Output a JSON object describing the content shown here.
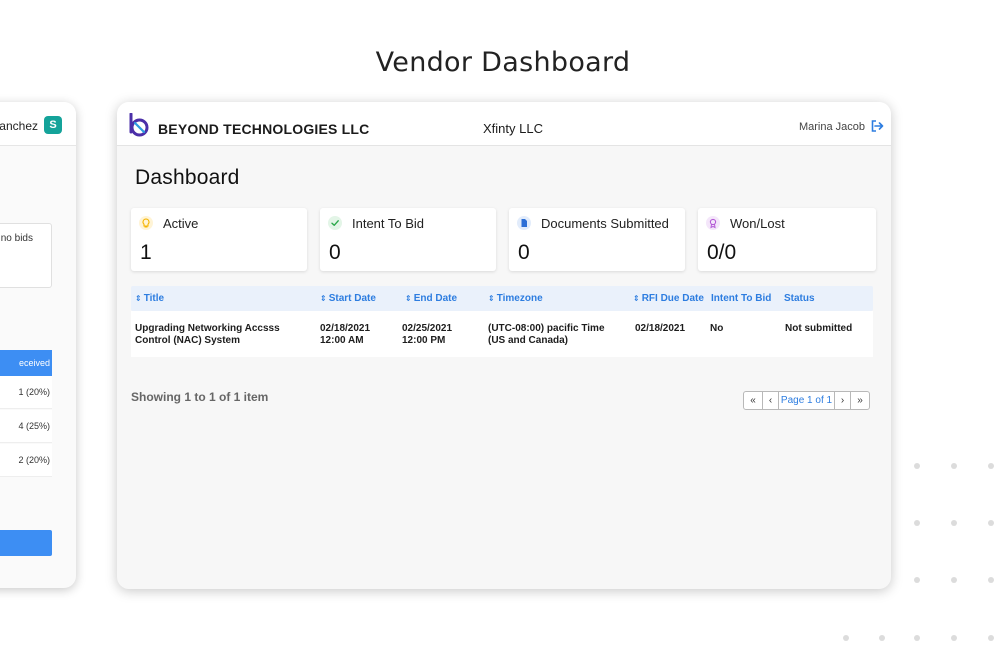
{
  "heading": "Vendor Dashboard",
  "side_card": {
    "user_partial": "anchez",
    "avatar_letter": "S",
    "box_text": "no bids",
    "table_head_partial": "eceived",
    "rows": [
      "1 (20%)",
      "4 (25%)",
      "2 (20%)"
    ]
  },
  "topbar": {
    "company": "BEYOND TECHNOLOGIES LLC",
    "vendor": "Xfinty LLC",
    "user": "Marina Jacob"
  },
  "page_title": "Dashboard",
  "stats": [
    {
      "label": "Active",
      "value": "1",
      "icon": "lightbulb-icon",
      "color": "#f5b400",
      "bg": "#fff4d6"
    },
    {
      "label": "Intent To Bid",
      "value": "0",
      "icon": "check-icon",
      "color": "#2aa84a",
      "bg": "#e3f5e7"
    },
    {
      "label": "Documents Submitted",
      "value": "0",
      "icon": "document-icon",
      "color": "#2d6fd6",
      "bg": "#e2ecfb"
    },
    {
      "label": "Won/Lost",
      "value": "0/0",
      "icon": "award-icon",
      "color": "#b45bd6",
      "bg": "#f4e6fa"
    }
  ],
  "table": {
    "headers": [
      "Title",
      "Start Date",
      "End Date",
      "Timezone",
      "RFI Due Date",
      "Intent To Bid",
      "Status"
    ],
    "rows": [
      {
        "title_line1": "Upgrading Networking Accsss",
        "title_line2": "Control (NAC) System",
        "start_date": "02/18/2021",
        "start_time": "12:00 AM",
        "end_date": "02/25/2021",
        "end_time": "12:00 PM",
        "timezone_line1": "(UTC-08:00)  pacific Time",
        "timezone_line2": "(US and Canada)",
        "rfi_due": "02/18/2021",
        "intent": "No",
        "status": "Not submitted"
      }
    ]
  },
  "showing": "Showing 1 to 1 of 1 item",
  "pager": {
    "first": "«",
    "prev": "‹",
    "page": "Page 1 of 1",
    "next": "›",
    "last": "»"
  },
  "colors": {
    "accent": "#2d7de0",
    "table_header_bg": "#eaf1fb",
    "side_accent": "#3d8ef3"
  }
}
